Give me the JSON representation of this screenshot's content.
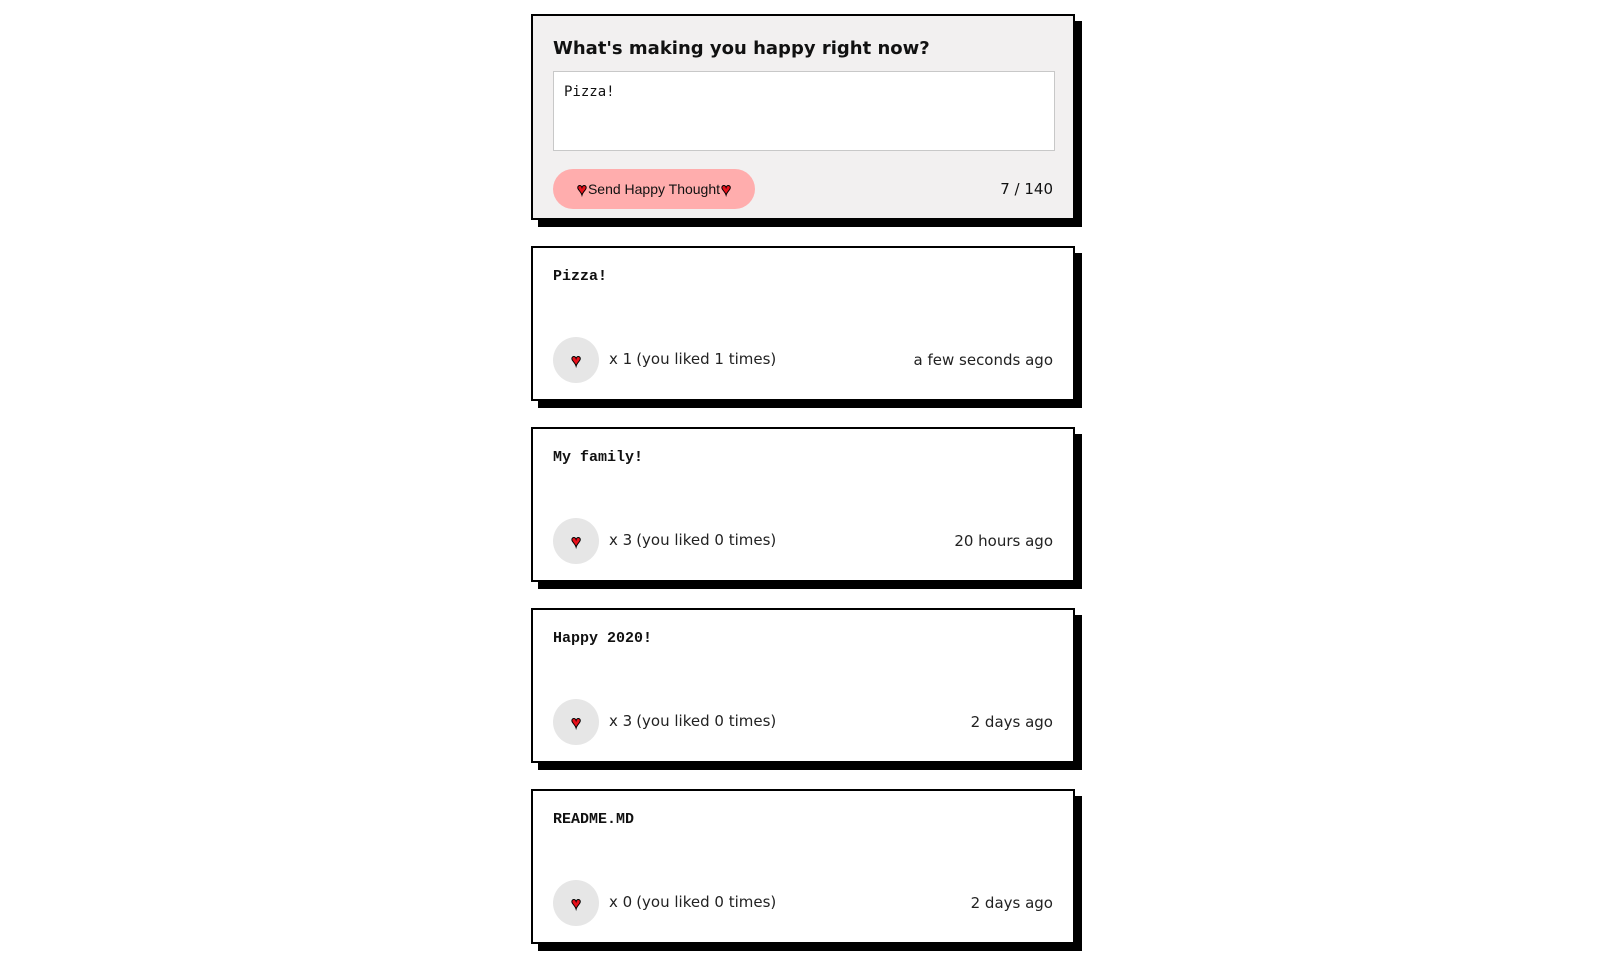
{
  "form": {
    "title": "What's making you happy right now?",
    "input_value": "Pizza!",
    "send_label": "Send Happy Thought",
    "char_count": "7 / 140"
  },
  "thoughts": [
    {
      "message": "Pizza!",
      "hearts": "x 1",
      "you_liked": "(you liked 1 times)",
      "time": "a few seconds ago"
    },
    {
      "message": "My family!",
      "hearts": "x 3",
      "you_liked": "(you liked 0 times)",
      "time": "20 hours ago"
    },
    {
      "message": "Happy 2020!",
      "hearts": "x 3",
      "you_liked": "(you liked 0 times)",
      "time": "2 days ago"
    },
    {
      "message": "README.MD",
      "hearts": "x 0",
      "you_liked": "(you liked 0 times)",
      "time": "2 days ago"
    }
  ],
  "icons": {
    "heart": "heart-icon"
  },
  "colors": {
    "send_button_bg": "#ffadad",
    "like_button_bg": "#e6e6e6",
    "heart": "#e8111b",
    "form_bg": "#f2f0f0"
  }
}
